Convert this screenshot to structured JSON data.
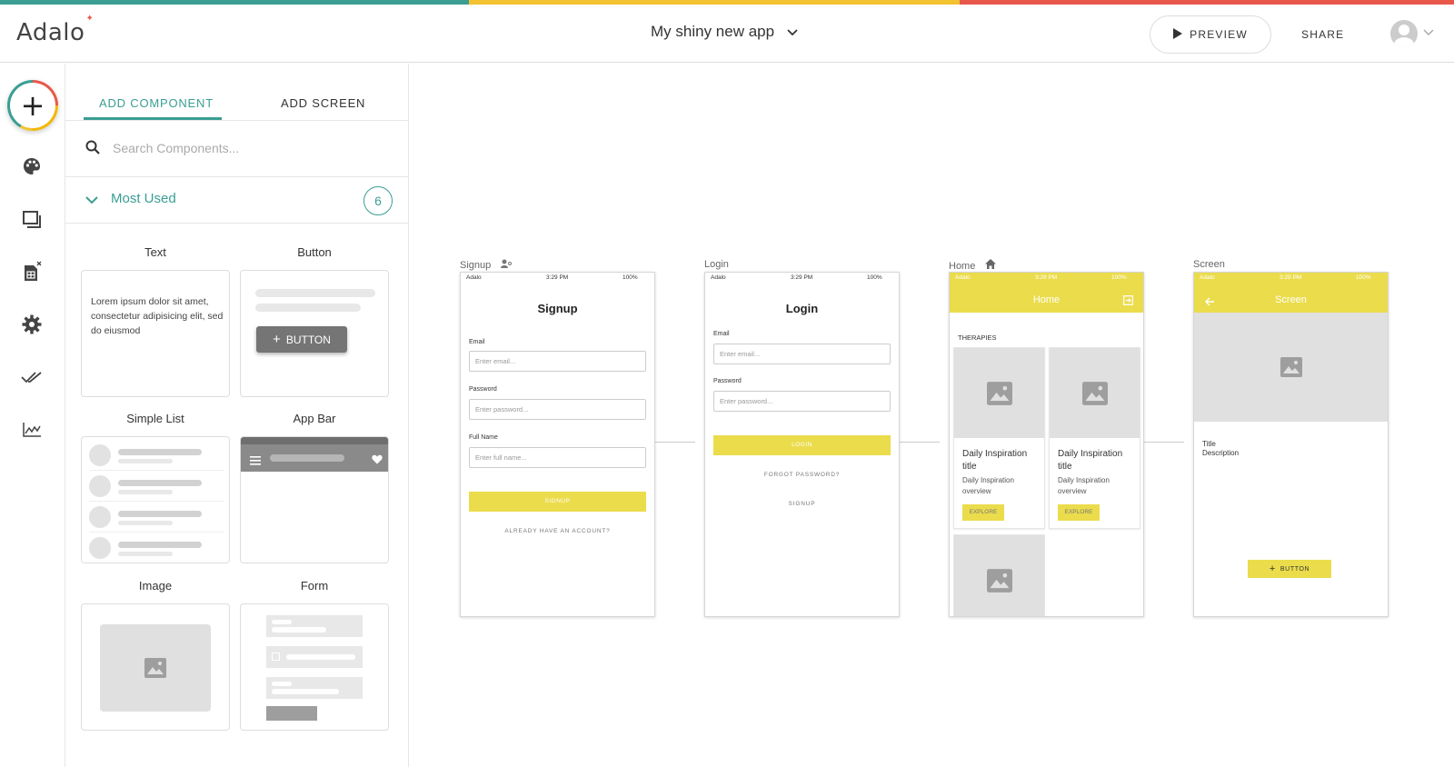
{
  "colors": {
    "teal": "#3a9e93",
    "amber": "#f2c230",
    "red": "#e8584a",
    "yellow": "#ebdc4c"
  },
  "header": {
    "logo": "Adalo",
    "app_name": "My shiny new app",
    "preview_label": "PREVIEW",
    "share_label": "SHARE"
  },
  "rail": {
    "items": [
      "add-icon",
      "palette-icon",
      "screens-icon",
      "database-icon",
      "gear-icon",
      "publish-check-icon",
      "analytics-icon"
    ]
  },
  "panel": {
    "tabs": [
      {
        "label": "ADD COMPONENT",
        "active": true
      },
      {
        "label": "ADD SCREEN",
        "active": false
      }
    ],
    "search_placeholder": "Search Components...",
    "section": {
      "label": "Most Used",
      "count": "6"
    },
    "components": [
      {
        "label": "Text"
      },
      {
        "label": "Button"
      },
      {
        "label": "Simple List"
      },
      {
        "label": "App Bar"
      },
      {
        "label": "Image"
      },
      {
        "label": "Form"
      }
    ],
    "text_preview": "Lorem ipsum dolor sit amet, consectetur adipisicing elit, sed do eiusmod",
    "button_preview": "BUTTON"
  },
  "canvas": {
    "status": {
      "carrier": "Adalo",
      "time": "3:29 PM",
      "battery": "100%"
    },
    "screens": [
      {
        "label": "Signup",
        "title": "Signup",
        "fields": [
          {
            "label": "Email",
            "placeholder": "Enter email..."
          },
          {
            "label": "Password",
            "placeholder": "Enter password..."
          },
          {
            "label": "Full Name",
            "placeholder": "Enter full name..."
          }
        ],
        "button": "SIGNUP",
        "link": "ALREADY HAVE AN ACCOUNT?"
      },
      {
        "label": "Login",
        "title": "Login",
        "fields": [
          {
            "label": "Email",
            "placeholder": "Enter email..."
          },
          {
            "label": "Password",
            "placeholder": "Enter password..."
          }
        ],
        "button": "LOGIN",
        "links": [
          "FORGOT PASSWORD?",
          "SIGNUP"
        ]
      },
      {
        "label": "Home",
        "appbar_title": "Home",
        "section": "THERAPIES",
        "cards": [
          {
            "title": "Daily Inspiration title",
            "overview": "Daily Inspiration overview",
            "button": "EXPLORE"
          },
          {
            "title": "Daily Inspiration title",
            "overview": "Daily Inspiration overview",
            "button": "EXPLORE"
          }
        ]
      },
      {
        "label": "Screen",
        "appbar_title": "Screen",
        "title": "Title",
        "description": "Description",
        "button": "BUTTON"
      }
    ]
  }
}
